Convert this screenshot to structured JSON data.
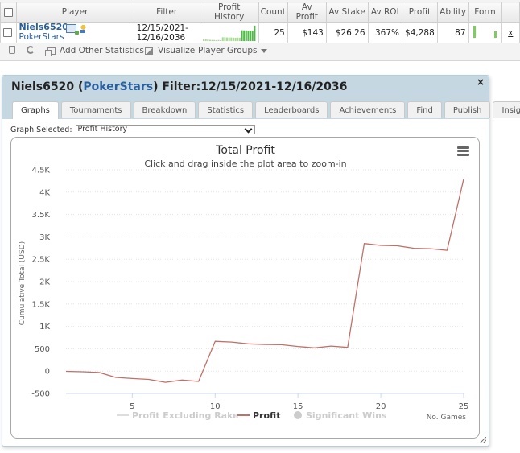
{
  "stats": {
    "columns": [
      "Player",
      "Filter",
      "Profit History",
      "Count",
      "Av Profit",
      "Av Stake",
      "Av ROI",
      "Profit",
      "Ability",
      "Form"
    ],
    "row": {
      "player_name": "Niels6520",
      "player_site": "PokerStars",
      "filter_line1": "12/15/2021-",
      "filter_line2": "12/16/2036",
      "count": "25",
      "av_profit": "$143",
      "av_stake": "$26.26",
      "av_roi": "367%",
      "profit": "$4,288",
      "ability": "87",
      "remove_link": "x"
    },
    "toolbar": {
      "add_stats": "Add Other Statistics",
      "visualize": "Visualize",
      "player_groups": "Player Groups"
    }
  },
  "panel": {
    "title_name": "Niels6520 (",
    "title_site": "PokerStars",
    "title_filter": ") Filter:12/15/2021-12/16/2036",
    "close": "×",
    "tabs": [
      "Graphs",
      "Tournaments",
      "Breakdown",
      "Statistics",
      "Leaderboards",
      "Achievements",
      "Find",
      "Publish",
      "Insights"
    ],
    "active_tab": "Graphs",
    "graph_select_label": "Graph Selected:",
    "graph_select_value": "Profit History"
  },
  "colors": {
    "profit_line": "#c07068",
    "accent_blue": "#2a5f9e",
    "panel_header": "#c5d7e0"
  },
  "chart_data": {
    "type": "line",
    "title": "Total Profit",
    "subtitle": "Click and drag inside the plot area to zoom-in",
    "ylabel": "Cumulative Total (USD)",
    "xlabel": "No. Games",
    "xlim": [
      1,
      25
    ],
    "ylim": [
      -500,
      4500
    ],
    "x_ticks": [
      5,
      10,
      15,
      20,
      25
    ],
    "y_ticks": [
      -500,
      0,
      500,
      1000,
      1500,
      2000,
      2500,
      3000,
      3500,
      4000,
      4500
    ],
    "y_tick_labels": [
      "-500",
      "0",
      "500",
      "1K",
      "1.5K",
      "2K",
      "2.5K",
      "3K",
      "3.5K",
      "4K",
      "4.5K"
    ],
    "grid": true,
    "legend_position": "bottom",
    "series": [
      {
        "name": "Profit",
        "color": "#c07068",
        "visible": true,
        "x": [
          1,
          2,
          3,
          4,
          5,
          6,
          7,
          8,
          9,
          10,
          11,
          12,
          13,
          14,
          15,
          16,
          17,
          18,
          19,
          20,
          21,
          22,
          23,
          24,
          25
        ],
        "y": [
          -5,
          -15,
          -30,
          -140,
          -165,
          -185,
          -250,
          -200,
          -230,
          665,
          650,
          610,
          595,
          590,
          550,
          520,
          560,
          530,
          2850,
          2810,
          2800,
          2745,
          2735,
          2700,
          4290
        ]
      },
      {
        "name": "Profit Excluding Rake",
        "visible": false
      },
      {
        "name": "Significant Wins",
        "visible": false
      }
    ]
  }
}
